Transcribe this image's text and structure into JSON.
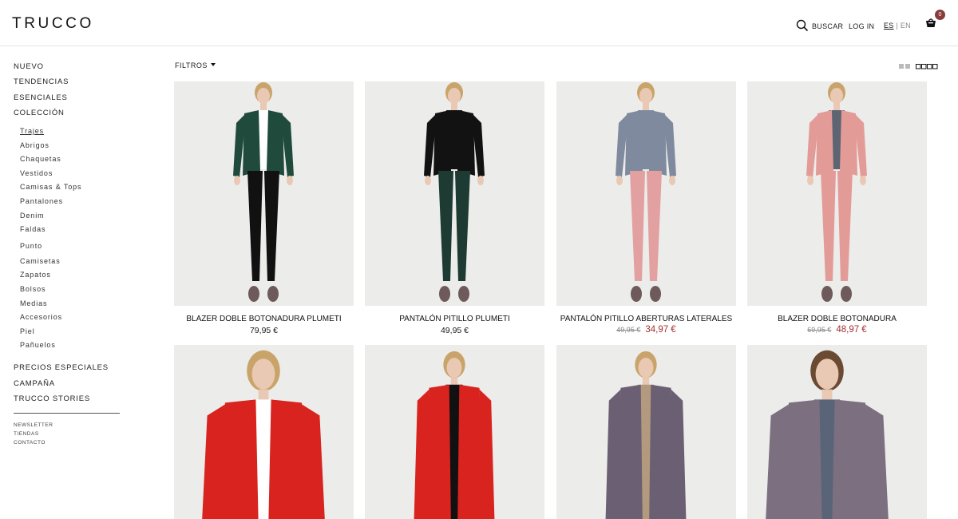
{
  "header": {
    "logo": "TRUCCO",
    "search_label": "BUSCAR",
    "login_label": "LOG IN",
    "lang_es": "ES",
    "lang_sep": "|",
    "lang_en": "EN",
    "cart_count": "0"
  },
  "sidebar": {
    "main_top": [
      "NUEVO",
      "TENDENCIAS",
      "ESENCIALES",
      "COLECCIÓN"
    ],
    "sub": [
      "Trajes",
      "Abrigos",
      "Chaquetas",
      "Vestidos",
      "Camisas & Tops",
      "Pantalones",
      "Denim",
      "Faldas",
      "Punto",
      "Camisetas",
      "Zapatos",
      "Bolsos",
      "Medias",
      "Accesorios",
      "Piel",
      "Pañuelos"
    ],
    "active_sub": "Trajes",
    "main_bottom": [
      "PRECIOS ESPECIALES",
      "CAMPAÑA",
      "TRUCCO STORIES"
    ],
    "small": [
      "NEWSLETTER",
      "TIENDAS",
      "CONTACTO"
    ]
  },
  "toolbar": {
    "filters_label": "FILTROS"
  },
  "products": [
    {
      "title": "BLAZER DOBLE BOTONADURA PLUMETI",
      "price": "79,95 €",
      "old_price": "",
      "sale_price": "",
      "top_color": "#1f4a3c",
      "bottom_color": "#111111",
      "shirt_color": "#ffffff"
    },
    {
      "title": "PANTALÓN PITILLO PLUMETI",
      "price": "49,95 €",
      "old_price": "",
      "sale_price": "",
      "top_color": "#121212",
      "bottom_color": "#1d3a33",
      "shirt_color": "#121212"
    },
    {
      "title": "PANTALÓN PITILLO ABERTURAS LATERALES",
      "price": "",
      "old_price": "49,95 €",
      "sale_price": "34,97 €",
      "top_color": "#7f8a9e",
      "bottom_color": "#e2a0a0",
      "shirt_color": "#7f8a9e"
    },
    {
      "title": "BLAZER DOBLE BOTONADURA",
      "price": "",
      "old_price": "69,95 €",
      "sale_price": "48,97 €",
      "top_color": "#e39b98",
      "bottom_color": "#e39b98",
      "shirt_color": "#5d6472"
    },
    {
      "title": "",
      "price": "",
      "old_price": "",
      "sale_price": "",
      "top_color": "#d8231f",
      "bottom_color": "#d8231f",
      "shirt_color": "#ffffff"
    },
    {
      "title": "",
      "price": "",
      "old_price": "",
      "sale_price": "",
      "top_color": "#d8231f",
      "bottom_color": "#d8231f",
      "shirt_color": "#111111"
    },
    {
      "title": "",
      "price": "",
      "old_price": "",
      "sale_price": "",
      "top_color": "#6b5f73",
      "bottom_color": "#6b5f73",
      "shirt_color": "#b39a7e"
    },
    {
      "title": "",
      "price": "",
      "old_price": "",
      "sale_price": "",
      "top_color": "#7b6f80",
      "bottom_color": "#7b6f80",
      "shirt_color": "#5a6478"
    }
  ]
}
